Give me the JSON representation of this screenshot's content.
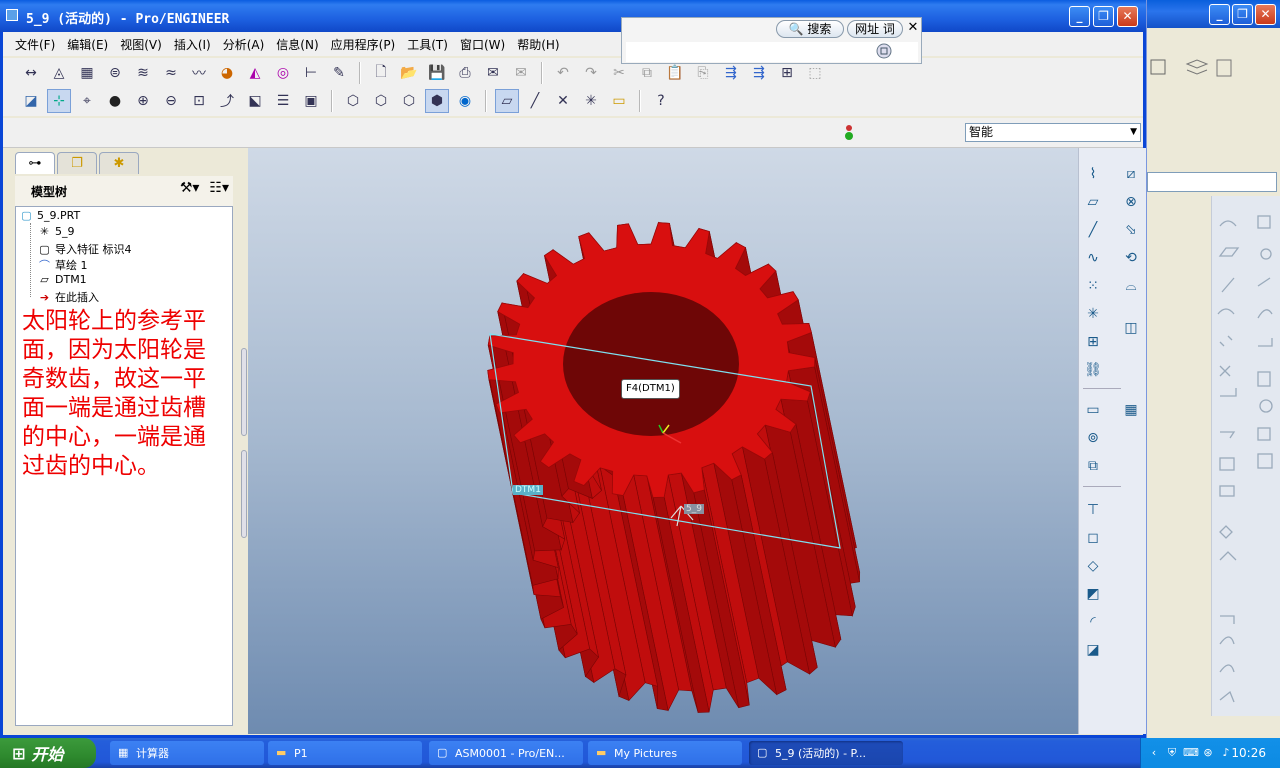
{
  "window": {
    "title": "5_9 (活动的) - Pro/ENGINEER"
  },
  "menubar": [
    "文件(F)",
    "编辑(E)",
    "视图(V)",
    "插入(I)",
    "分析(A)",
    "信息(N)",
    "应用程序(P)",
    "工具(T)",
    "窗口(W)",
    "帮助(H)"
  ],
  "filter": {
    "selected": "智能"
  },
  "search_popup": {
    "search_label": "搜索",
    "url_label": "网址 词",
    "close": "✕"
  },
  "model_tree": {
    "title": "模型树",
    "nodes": [
      {
        "label": "5_9.PRT",
        "icon": "part-icon"
      },
      {
        "label": "5_9",
        "icon": "csys-icon"
      },
      {
        "label": "导入特征 标识4",
        "icon": "import-feature-icon"
      },
      {
        "label": "草绘 1",
        "icon": "sketch-icon"
      },
      {
        "label": "DTM1",
        "icon": "datum-plane-icon"
      },
      {
        "label": "在此插入",
        "icon": "insert-here-arrow-icon"
      }
    ]
  },
  "annotation": "太阳轮上的参考平面，因为太阳轮是奇数齿，故这一平面一端是通过齿槽的中心，一端是通过齿的中心。",
  "viewport": {
    "pick_label": "F4(DTM1)",
    "datum_tag": "DTM1",
    "csys_tag": "5_9",
    "gear_color": "#d80f0f",
    "gear_hole_color": "#6e0606"
  },
  "taskbar": {
    "start_label": "开始",
    "tasks": [
      {
        "label": "计算器",
        "icon": "calculator-icon"
      },
      {
        "label": "P1",
        "icon": "folder-icon"
      },
      {
        "label": "ASM0001 - Pro/EN...",
        "icon": "proe-icon"
      },
      {
        "label": "My Pictures",
        "icon": "folder-icon"
      },
      {
        "label": "5_9 (活动的) - P...",
        "icon": "proe-icon"
      }
    ],
    "clock": "10:26"
  }
}
